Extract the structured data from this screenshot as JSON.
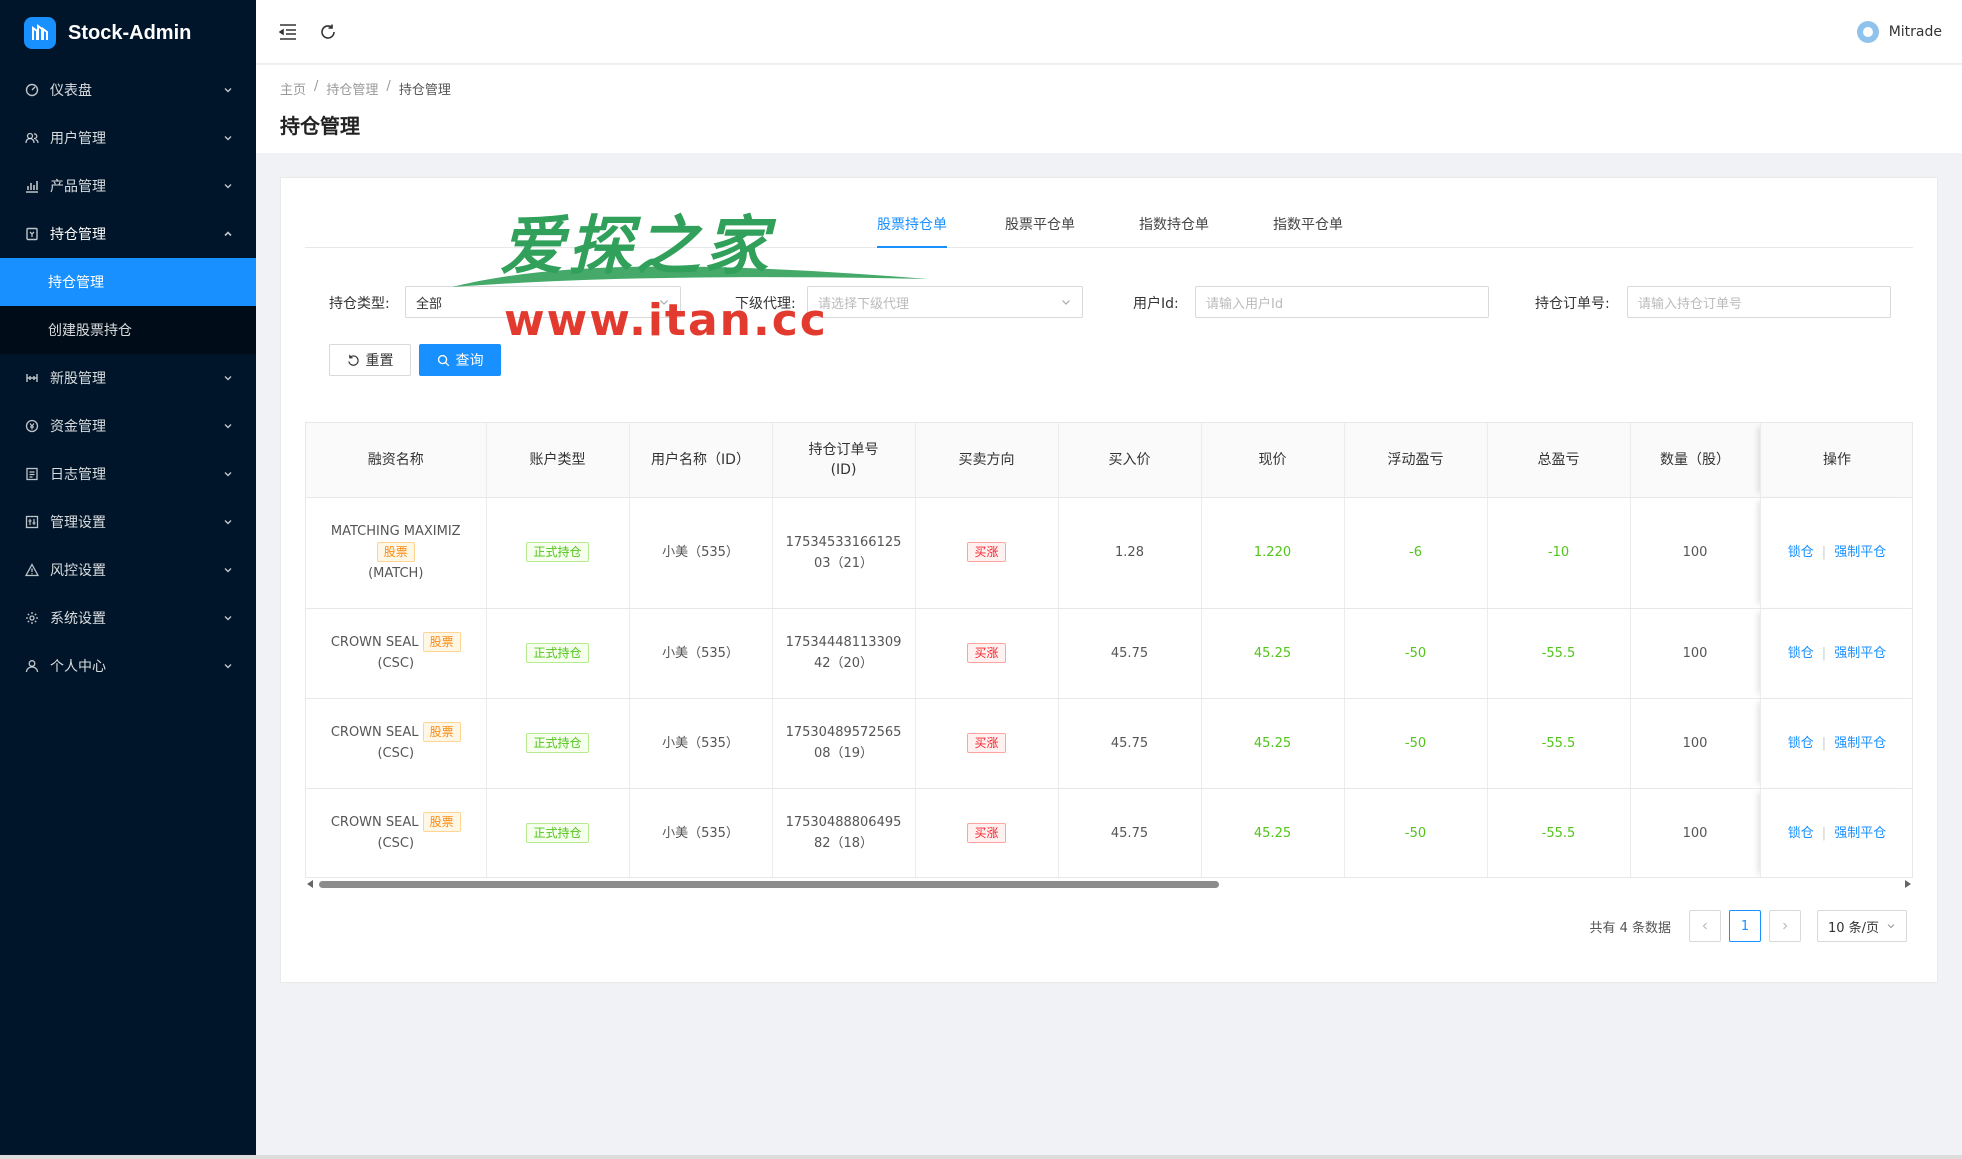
{
  "app": {
    "title": "Stock-Admin"
  },
  "sidebar": {
    "items": [
      {
        "label": "仪表盘",
        "icon": "dashboard-icon"
      },
      {
        "label": "用户管理",
        "icon": "users-icon"
      },
      {
        "label": "产品管理",
        "icon": "chart-icon"
      },
      {
        "label": "持仓管理",
        "icon": "position-icon",
        "open": true,
        "children": [
          {
            "label": "持仓管理",
            "active": true
          },
          {
            "label": "创建股票持仓"
          }
        ]
      },
      {
        "label": "新股管理",
        "icon": "ipo-icon"
      },
      {
        "label": "资金管理",
        "icon": "money-icon"
      },
      {
        "label": "日志管理",
        "icon": "log-icon"
      },
      {
        "label": "管理设置",
        "icon": "admin-settings-icon"
      },
      {
        "label": "风控设置",
        "icon": "warning-icon"
      },
      {
        "label": "系统设置",
        "icon": "gear-icon"
      },
      {
        "label": "个人中心",
        "icon": "user-icon"
      }
    ]
  },
  "header": {
    "username": "Mitrade"
  },
  "breadcrumb": [
    "主页",
    "持仓管理",
    "持仓管理"
  ],
  "page": {
    "title": "持仓管理"
  },
  "tabs": [
    "股票持仓单",
    "股票平仓单",
    "指数持仓单",
    "指数平仓单"
  ],
  "filters": {
    "type_label": "持仓类型:",
    "type_value": "全部",
    "agent_label": "下级代理:",
    "agent_placeholder": "请选择下级代理",
    "userid_label": "用户Id:",
    "userid_placeholder": "请输入用户Id",
    "order_label": "持仓订单号:",
    "order_placeholder": "请输入持仓订单号"
  },
  "buttons": {
    "reset": "重置",
    "query": "查询"
  },
  "table": {
    "headers": [
      "融资名称",
      "账户类型",
      "用户名称（ID）",
      "持仓订单号",
      "(ID)",
      "买卖方向",
      "买入价",
      "现价",
      "浮动盈亏",
      "总盈亏",
      "数量（股）",
      "操作"
    ],
    "rows": [
      {
        "name": "MATCHING MAXIMIZ",
        "tag": "股票",
        "code": "(MATCH)",
        "acct": "正式持仓",
        "user": "小美（535）",
        "order1": "17534533166125",
        "order2": "03（21）",
        "dir": "买涨",
        "buy": "1.28",
        "now": "1.220",
        "float": "-6",
        "total": "-10",
        "qty": "100",
        "op1": "锁仓",
        "op2": "强制平仓"
      },
      {
        "name": "CROWN SEAL",
        "tag": "股票",
        "code": "(CSC)",
        "acct": "正式持仓",
        "user": "小美（535）",
        "order1": "17534448113309",
        "order2": "42（20）",
        "dir": "买涨",
        "buy": "45.75",
        "now": "45.25",
        "float": "-50",
        "total": "-55.5",
        "qty": "100",
        "op1": "锁仓",
        "op2": "强制平仓"
      },
      {
        "name": "CROWN SEAL",
        "tag": "股票",
        "code": "(CSC)",
        "acct": "正式持仓",
        "user": "小美（535）",
        "order1": "17530489572565",
        "order2": "08（19）",
        "dir": "买涨",
        "buy": "45.75",
        "now": "45.25",
        "float": "-50",
        "total": "-55.5",
        "qty": "100",
        "op1": "锁仓",
        "op2": "强制平仓"
      },
      {
        "name": "CROWN SEAL",
        "tag": "股票",
        "code": "(CSC)",
        "acct": "正式持仓",
        "user": "小美（535）",
        "order1": "17530488806495",
        "order2": "82（18）",
        "dir": "买涨",
        "buy": "45.75",
        "now": "45.25",
        "float": "-50",
        "total": "-55.5",
        "qty": "100",
        "op1": "锁仓",
        "op2": "强制平仓"
      }
    ]
  },
  "pagination": {
    "total_text": "共有 4 条数据",
    "current": "1",
    "page_size": "10 条/页"
  },
  "watermark": {
    "top": "爱探之家",
    "url": "www.itan.cc"
  },
  "colors": {
    "accent": "#1890ff",
    "sidebar": "#001529",
    "profit": "#52c41a",
    "loss_tag": "#f5222d",
    "stock_tag": "#fa8c16"
  }
}
